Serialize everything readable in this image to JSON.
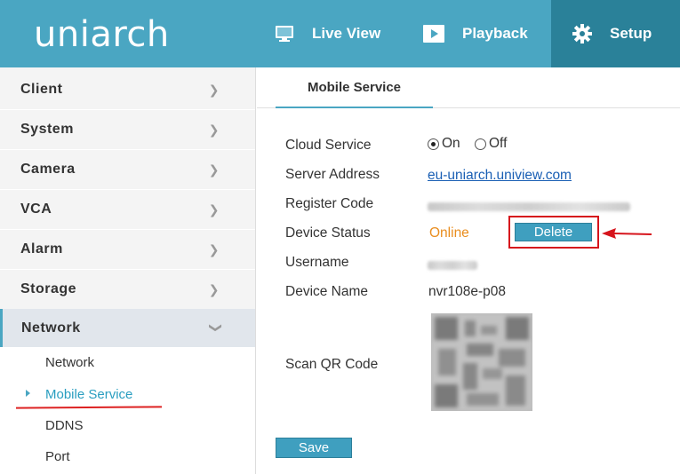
{
  "brand": {
    "logo_text": "uniarch"
  },
  "topnav": {
    "live_view": "Live View",
    "playback": "Playback",
    "setup": "Setup"
  },
  "sidebar": {
    "items": [
      {
        "label": "Client"
      },
      {
        "label": "System"
      },
      {
        "label": "Camera"
      },
      {
        "label": "VCA"
      },
      {
        "label": "Alarm"
      },
      {
        "label": "Storage"
      },
      {
        "label": "Network"
      }
    ],
    "sub_items": [
      {
        "label": "Network"
      },
      {
        "label": "Mobile Service"
      },
      {
        "label": "DDNS"
      },
      {
        "label": "Port"
      }
    ]
  },
  "main": {
    "tab": "Mobile Service",
    "fields": {
      "cloud_service_label": "Cloud Service",
      "cloud_on": "On",
      "cloud_off": "Off",
      "cloud_selected": "On",
      "server_address_label": "Server Address",
      "server_address_value": "eu-uniarch.uniview.com",
      "register_code_label": "Register Code",
      "device_status_label": "Device Status",
      "device_status_value": "Online",
      "delete_label": "Delete",
      "username_label": "Username",
      "device_name_label": "Device Name",
      "device_name_value": "nvr108e-p08",
      "scan_qr_label": "Scan QR Code"
    },
    "save_label": "Save"
  },
  "colors": {
    "header": "#4aa6c2",
    "header_active": "#2a8199",
    "accent": "#3f9fbf",
    "online": "#e98d1e",
    "annotation": "#d6141c"
  }
}
